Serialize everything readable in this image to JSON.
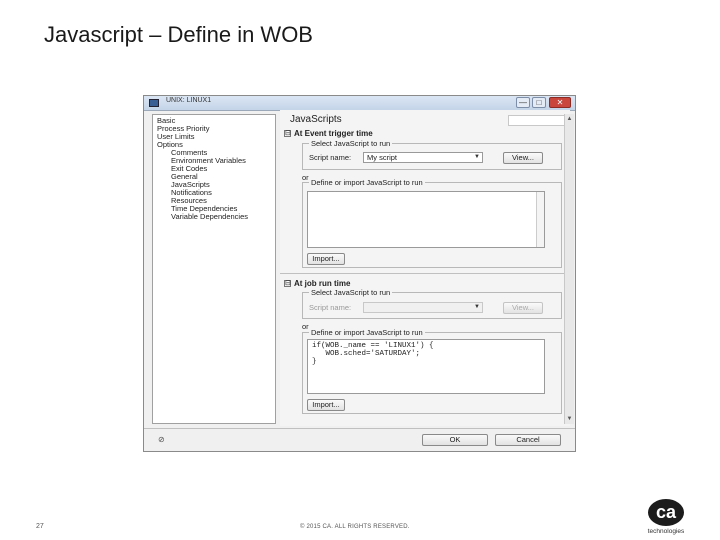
{
  "slide": {
    "title": "Javascript – Define in WOB",
    "page_number": "27",
    "copyright": "© 2015 CA. ALL RIGHTS RESERVED.",
    "logo_mark": "ca",
    "logo_caption": "technologies"
  },
  "window": {
    "title": "UNIX: LINUX1",
    "buttons": {
      "minimize": "—",
      "maximize": "□",
      "close": "✕"
    }
  },
  "tree": {
    "items": [
      {
        "label": "Basic",
        "level": 0
      },
      {
        "label": "Process Priority",
        "level": 0
      },
      {
        "label": "User Limits",
        "level": 0
      },
      {
        "label": "Options",
        "level": 0
      },
      {
        "label": "Comments",
        "level": 1
      },
      {
        "label": "Environment Variables",
        "level": 1
      },
      {
        "label": "Exit Codes",
        "level": 1
      },
      {
        "label": "General",
        "level": 1
      },
      {
        "label": "JavaScripts",
        "level": 1
      },
      {
        "label": "Notifications",
        "level": 1
      },
      {
        "label": "Resources",
        "level": 1
      },
      {
        "label": "Time Dependencies",
        "level": 1
      },
      {
        "label": "Variable Dependencies",
        "level": 1
      }
    ]
  },
  "panel": {
    "title": "JavaScripts",
    "event_section": {
      "toggle": "⊟",
      "heading": "At Event trigger time",
      "select_group_label": "Select JavaScript to run",
      "script_name_label": "Script name:",
      "script_name_value": "My script",
      "view_button": "View...",
      "or_label": "or",
      "define_group_label": "Define or import JavaScript to run",
      "import_button": "Import..."
    },
    "job_section": {
      "toggle": "⊟",
      "heading": "At job run time",
      "select_group_label": "Select JavaScript to run",
      "script_name_label": "Script name:",
      "script_name_value": "",
      "view_button": "View...",
      "or_label": "or",
      "define_group_label": "Define or import JavaScript to run",
      "code_lines": [
        "if(WOB._name == 'LINUX1') {",
        "   WOB.sched='SATURDAY';",
        "}"
      ],
      "import_button": "Import..."
    }
  },
  "footer_buttons": {
    "ok": "OK",
    "cancel": "Cancel"
  },
  "colors": {
    "accent": "#3a5f95",
    "close": "#c9463d"
  }
}
